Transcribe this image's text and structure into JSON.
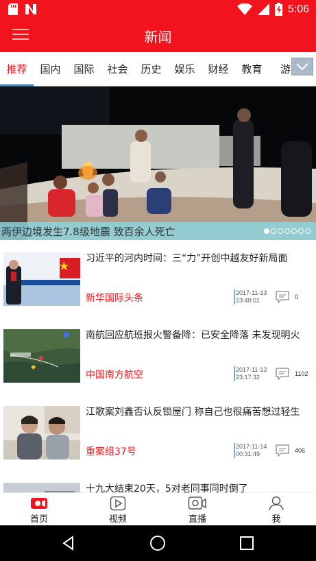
{
  "status_bar": {
    "time": "5:06",
    "icons": [
      "sd-card-icon",
      "notification-n-icon",
      "wifi-icon",
      "signal-icon",
      "battery-icon"
    ]
  },
  "app_bar": {
    "title": "新闻",
    "menu_icon": "menu-icon"
  },
  "tabs": {
    "items": [
      "推荐",
      "国内",
      "国际",
      "社会",
      "历史",
      "娱乐",
      "财经",
      "教育",
      "游"
    ],
    "active_index": 0,
    "more_icon": "chevron-down-icon"
  },
  "banner": {
    "caption": "两伊边境发生7.8级地震 致百余人死亡",
    "dot_count": 7,
    "active_dot": 0
  },
  "news": [
    {
      "headline": "习近平的河内时间：三“力”开创中越友好新局面",
      "source": "新华国际头条",
      "date": "2017-11-13",
      "time": "23:40:01",
      "comments": "0"
    },
    {
      "headline": "南航回应航班报火警备降：已安全降落 未发现明火",
      "source": "中国南方航空",
      "date": "2017-11-13",
      "time": "23:17:32",
      "comments": "1102"
    },
    {
      "headline": "江歌案刘鑫否认反锁屋门 称自己也很痛苦想过轻生",
      "source": "重案组37号",
      "date": "2017-11-14",
      "time": "00:31:49",
      "comments": "406"
    },
    {
      "headline": "十九大结束20天，5对老同事同时倒了",
      "source": "",
      "date": "",
      "time": "",
      "comments": ""
    }
  ],
  "bottom_nav": {
    "items": [
      {
        "label": "首页",
        "icon": "home-video-icon",
        "active": true
      },
      {
        "label": "视频",
        "icon": "play-icon",
        "active": false
      },
      {
        "label": "直播",
        "icon": "camera-icon",
        "active": false
      },
      {
        "label": "我",
        "icon": "user-icon",
        "active": false
      }
    ]
  },
  "colors": {
    "accent": "#f2141c",
    "tab_indicator": "#2a8fd8",
    "caption_bar": "#8cd7e1"
  }
}
